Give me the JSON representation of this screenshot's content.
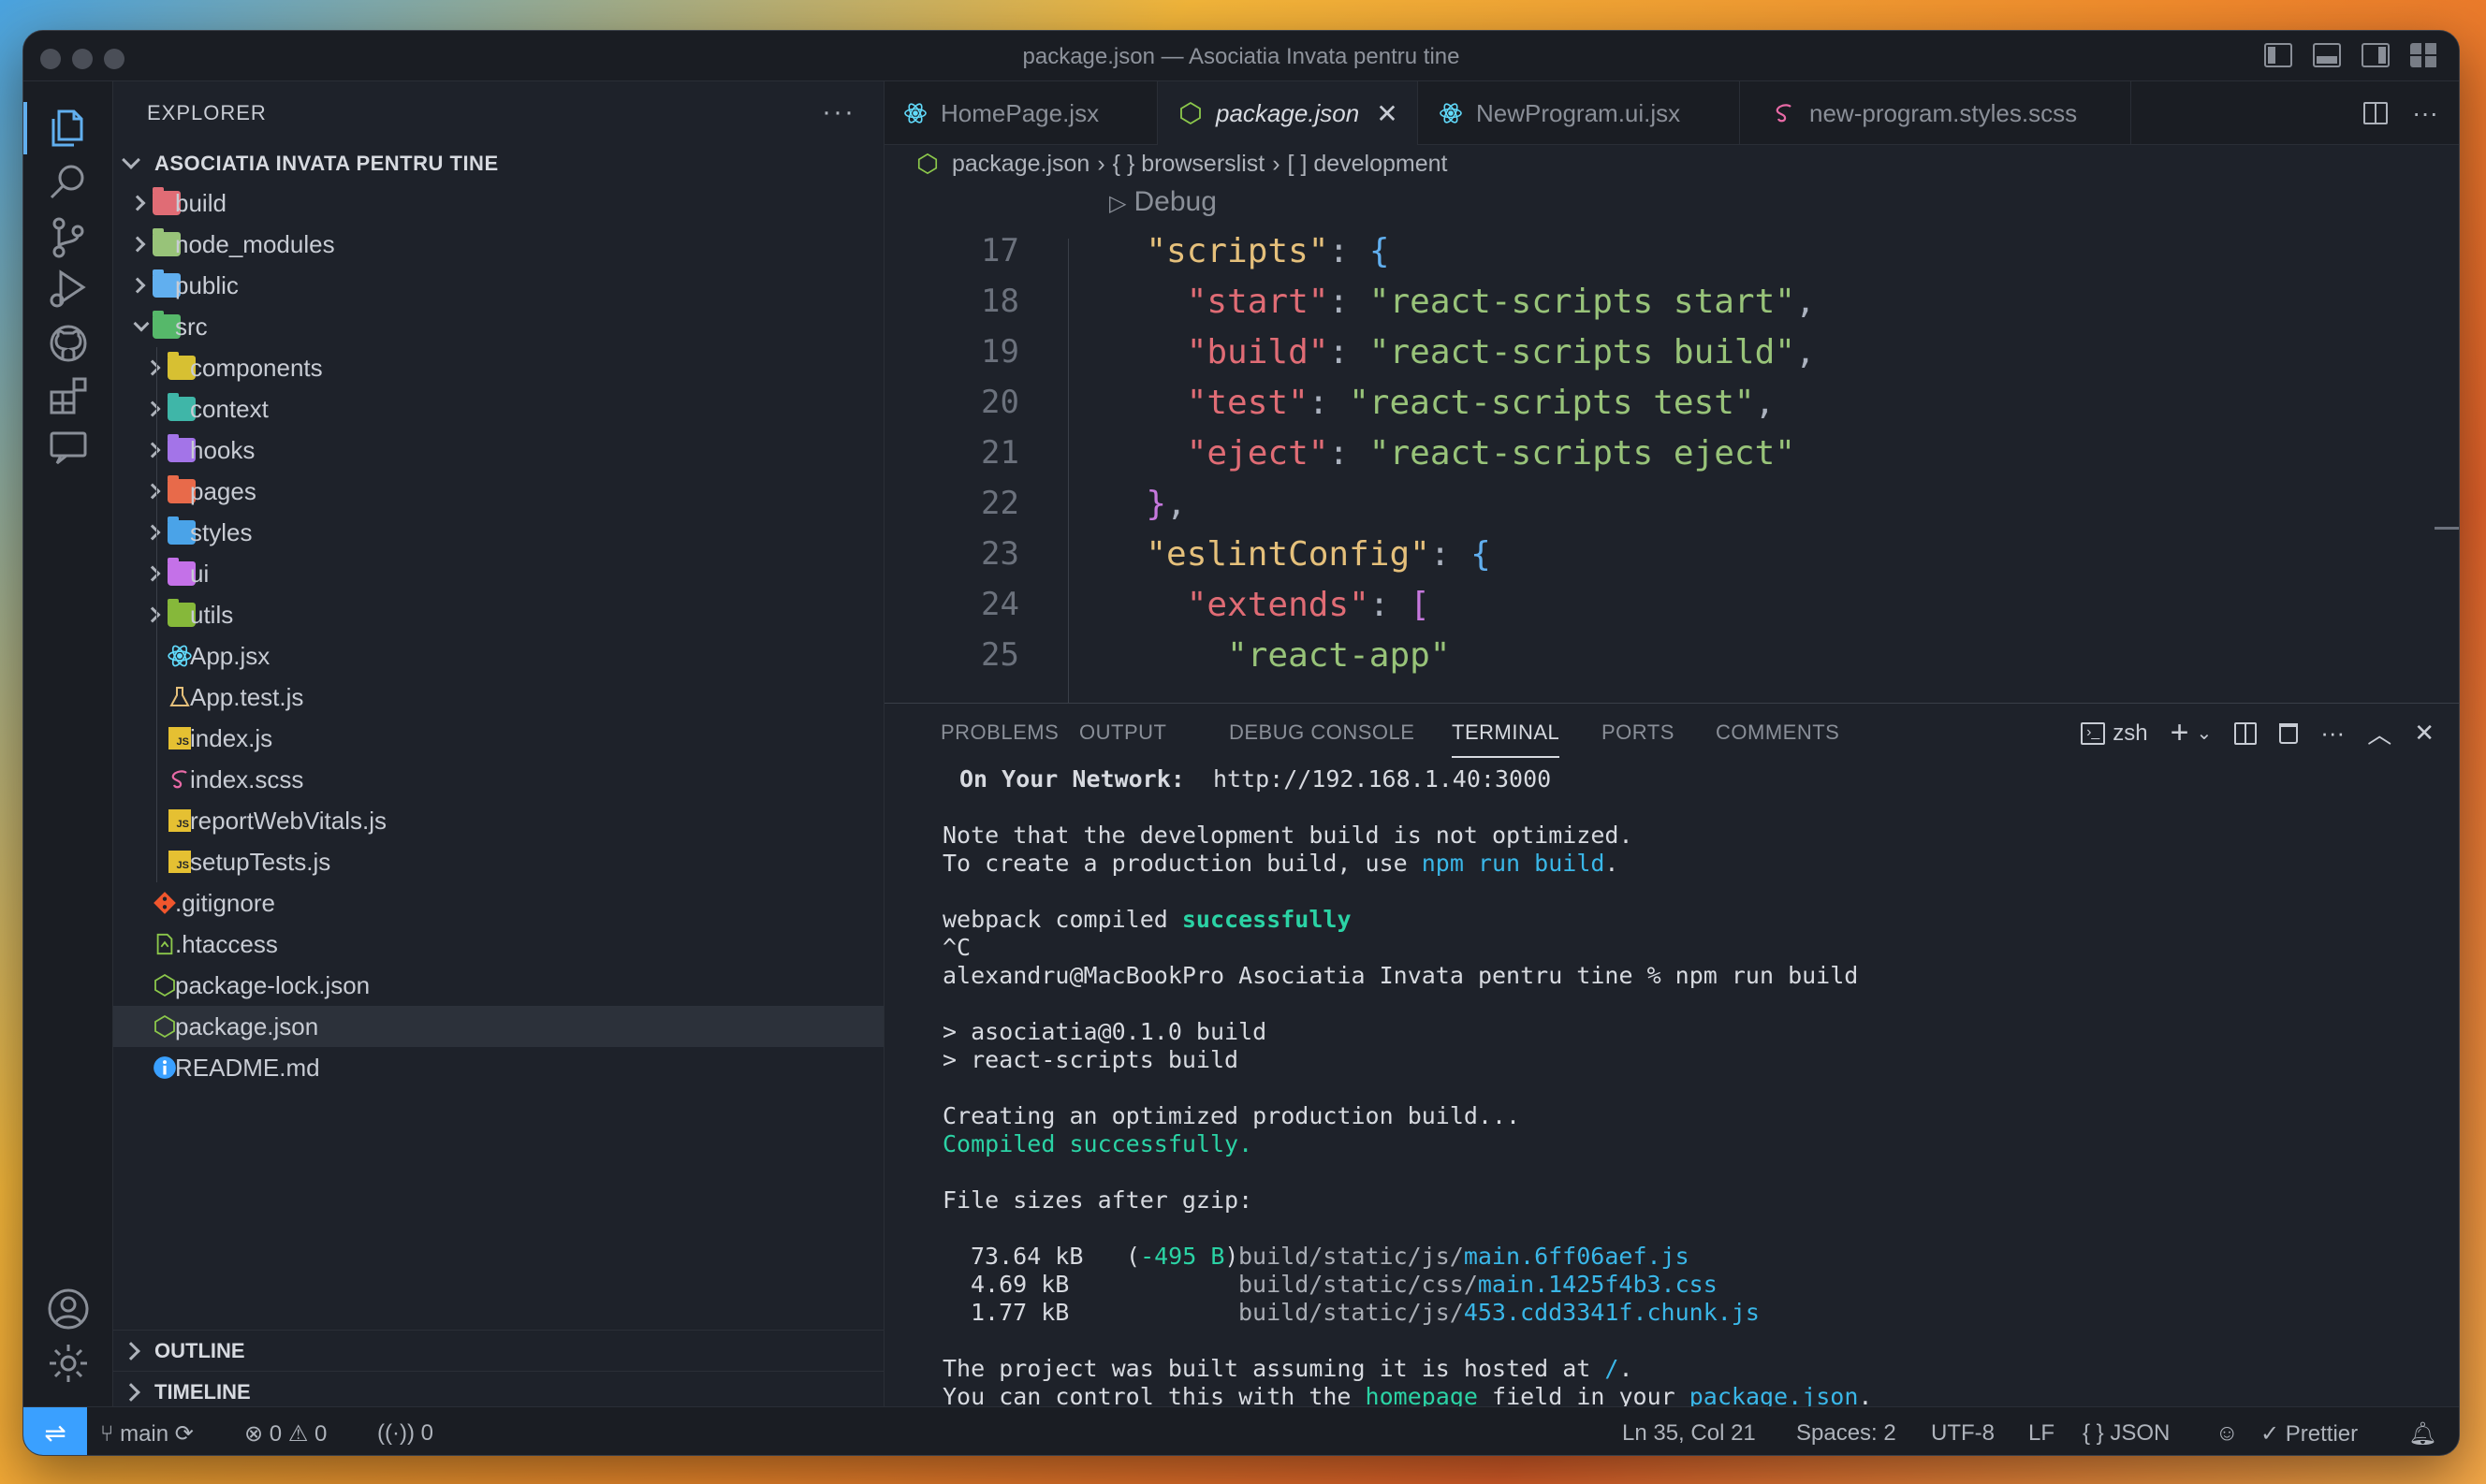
{
  "window": {
    "title": "package.json — Asociatia Invata pentru tine"
  },
  "sidebar": {
    "header": "EXPLORER",
    "more": "···",
    "root": "ASOCIATIA INVATA PENTRU TINE",
    "items": [
      {
        "label": "build",
        "type": "folder",
        "color": "#e06c75"
      },
      {
        "label": "node_modules",
        "type": "folder",
        "color": "#98c379"
      },
      {
        "label": "public",
        "type": "folder",
        "color": "#61afef"
      },
      {
        "label": "src",
        "type": "folder",
        "color": "#56b86a"
      },
      {
        "label": "components",
        "type": "folder",
        "color": "#d7c032"
      },
      {
        "label": "context",
        "type": "folder",
        "color": "#3fb6a8"
      },
      {
        "label": "hooks",
        "type": "folder",
        "color": "#a374e8"
      },
      {
        "label": "pages",
        "type": "folder",
        "color": "#e86a4a"
      },
      {
        "label": "styles",
        "type": "folder",
        "color": "#4aa3e8"
      },
      {
        "label": "ui",
        "type": "folder",
        "color": "#c471e8"
      },
      {
        "label": "utils",
        "type": "folder",
        "color": "#86b83a"
      },
      {
        "label": "App.jsx",
        "type": "file",
        "icon": "react-icon"
      },
      {
        "label": "App.test.js",
        "type": "file",
        "icon": "flask-icon"
      },
      {
        "label": "index.js",
        "type": "file",
        "icon": "js-icon"
      },
      {
        "label": "index.scss",
        "type": "file",
        "icon": "sass-icon"
      },
      {
        "label": "reportWebVitals.js",
        "type": "file",
        "icon": "js-icon"
      },
      {
        "label": "setupTests.js",
        "type": "file",
        "icon": "js-icon"
      },
      {
        "label": ".gitignore",
        "type": "file",
        "icon": "git-icon"
      },
      {
        "label": ".htaccess",
        "type": "file",
        "icon": "file-icon"
      },
      {
        "label": "package-lock.json",
        "type": "file",
        "icon": "node-icon"
      },
      {
        "label": "package.json",
        "type": "file",
        "icon": "node-icon"
      },
      {
        "label": "README.md",
        "type": "file",
        "icon": "info-icon"
      }
    ],
    "outline": "OUTLINE",
    "timeline": "TIMELINE"
  },
  "tabs": [
    {
      "label": "HomePage.jsx"
    },
    {
      "label": "package.json",
      "close": "✕"
    },
    {
      "label": "NewProgram.ui.jsx"
    },
    {
      "label": "new-program.styles.scss"
    }
  ],
  "tab_more": "···",
  "breadcrumb": [
    "package.json",
    "{ } browserslist",
    "[ ] development"
  ],
  "editor": {
    "codelens": "Debug",
    "lines": [
      {
        "n": "17",
        "text": "  \"scripts\": {"
      },
      {
        "n": "18",
        "text": "    \"start\": \"react-scripts start\","
      },
      {
        "n": "19",
        "text": "    \"build\": \"react-scripts build\","
      },
      {
        "n": "20",
        "text": "    \"test\": \"react-scripts test\","
      },
      {
        "n": "21",
        "text": "    \"eject\": \"react-scripts eject\""
      },
      {
        "n": "22",
        "text": "  },"
      },
      {
        "n": "23",
        "text": "  \"eslintConfig\": {"
      },
      {
        "n": "24",
        "text": "    \"extends\": ["
      },
      {
        "n": "25",
        "text": "      \"react-app\""
      }
    ]
  },
  "panel": {
    "tabs": [
      "PROBLEMS",
      "OUTPUT",
      "DEBUG CONSOLE",
      "TERMINAL",
      "PORTS",
      "COMMENTS"
    ],
    "shell": "zsh",
    "more": "···",
    "terminal": {
      "network_label": "On Your Network:",
      "network_url": "http://192.168.1.40:3000",
      "note1": "Note that the development build is not optimized.",
      "note2a": "To create a production build, use ",
      "note2b": "npm run build",
      "note2c": ".",
      "compiled_a": "webpack compiled ",
      "compiled_b": "successfully",
      "ctrl_c": "^C",
      "prompt": "alexandru@MacBookPro Asociatia Invata pentru tine % npm run build",
      "run1": "> asociatia@0.1.0 build",
      "run2": "> react-scripts build",
      "creating": "Creating an optimized production build...",
      "compiled_ok": "Compiled successfully.",
      "sizes_header": "File sizes after gzip:",
      "size1": "73.64 kB",
      "size1_paren_open": "(",
      "size1_delta": "-495 B",
      "size1_paren_close": ")",
      "path1": "build/static/js/",
      "file1": "main.6ff06aef.js",
      "size2": "4.69 kB",
      "path2": "build/static/css/",
      "file2": "main.1425f4b3.css",
      "size3": "1.77 kB",
      "path3": "build/static/js/",
      "file3": "453.cdd3341f.chunk.js",
      "host_a": "The project was built assuming it is hosted at ",
      "host_b": "/",
      "host_c": ".",
      "ctrl_a": "You can control this with the ",
      "ctrl_b": "homepage",
      "ctrl_c2": " field in your ",
      "ctrl_d": "package.json",
      "ctrl_e": "."
    }
  },
  "statusbar": {
    "remote": "⇌",
    "branch": "main",
    "errors": "0",
    "warnings": "0",
    "ports": "0",
    "position": "Ln 35, Col 21",
    "spaces": "Spaces: 2",
    "encoding": "UTF-8",
    "eol": "LF",
    "language": "JSON",
    "formatter": "Prettier"
  }
}
